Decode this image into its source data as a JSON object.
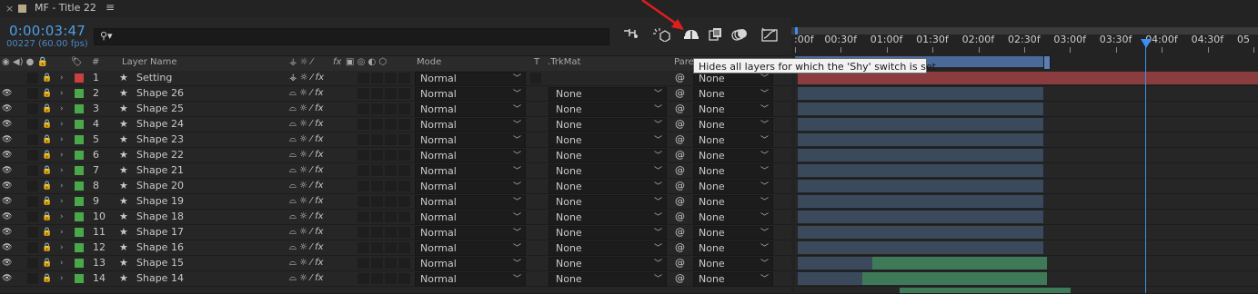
{
  "tab": {
    "close": "×",
    "title": "MF - Title 22",
    "menu": "≡"
  },
  "timecode": "0:00:03:47",
  "frames": "00227 (60.00 fps)",
  "search": {
    "placeholder": "",
    "icon": "search-icon"
  },
  "toolbar_icons": [
    "flowchart-icon",
    "draft-3d-icon",
    "shy-icon",
    "frame-blending-icon",
    "motion-blur-icon",
    "graph-editor-icon"
  ],
  "columns": {
    "layer_name": "Layer Name",
    "hash": "#",
    "mode": "Mode",
    "t": "T",
    "trkmat": "TrkMat",
    "parent": "Pare",
    "switches": "fx"
  },
  "tooltip": "Hides all layers for which the 'Shy' switch is set",
  "timeline": {
    "ticks": [
      ":00f",
      "00:30f",
      "01:00f",
      "01:30f",
      "02:00f",
      "02:30f",
      "03:00f",
      "03:30f",
      "04:00f",
      "04:30f",
      "05"
    ]
  },
  "layers": [
    {
      "num": "1",
      "name": "Setting",
      "mode": "Normal",
      "trkmat": "",
      "parent": "None",
      "label_color": "#c94040"
    },
    {
      "num": "2",
      "name": "Shape 26",
      "mode": "Normal",
      "trkmat": "None",
      "parent": "None",
      "label_color": "#4aa84a"
    },
    {
      "num": "3",
      "name": "Shape 25",
      "mode": "Normal",
      "trkmat": "None",
      "parent": "None",
      "label_color": "#4aa84a"
    },
    {
      "num": "4",
      "name": "Shape 24",
      "mode": "Normal",
      "trkmat": "None",
      "parent": "None",
      "label_color": "#4aa84a"
    },
    {
      "num": "5",
      "name": "Shape 23",
      "mode": "Normal",
      "trkmat": "None",
      "parent": "None",
      "label_color": "#4aa84a"
    },
    {
      "num": "6",
      "name": "Shape 22",
      "mode": "Normal",
      "trkmat": "None",
      "parent": "None",
      "label_color": "#4aa84a"
    },
    {
      "num": "7",
      "name": "Shape 21",
      "mode": "Normal",
      "trkmat": "None",
      "parent": "None",
      "label_color": "#4aa84a"
    },
    {
      "num": "8",
      "name": "Shape 20",
      "mode": "Normal",
      "trkmat": "None",
      "parent": "None",
      "label_color": "#4aa84a"
    },
    {
      "num": "9",
      "name": "Shape 19",
      "mode": "Normal",
      "trkmat": "None",
      "parent": "None",
      "label_color": "#4aa84a"
    },
    {
      "num": "10",
      "name": "Shape 18",
      "mode": "Normal",
      "trkmat": "None",
      "parent": "None",
      "label_color": "#4aa84a"
    },
    {
      "num": "11",
      "name": "Shape 17",
      "mode": "Normal",
      "trkmat": "None",
      "parent": "None",
      "label_color": "#4aa84a"
    },
    {
      "num": "12",
      "name": "Shape 16",
      "mode": "Normal",
      "trkmat": "None",
      "parent": "None",
      "label_color": "#4aa84a"
    },
    {
      "num": "13",
      "name": "Shape 15",
      "mode": "Normal",
      "trkmat": "None",
      "parent": "None",
      "label_color": "#4aa84a"
    },
    {
      "num": "14",
      "name": "Shape 14",
      "mode": "Normal",
      "trkmat": "None",
      "parent": "None",
      "label_color": "#4aa84a"
    }
  ],
  "colors": {
    "accent": "#4f9ee8",
    "layer_bar_setting": "#8a3c3f",
    "layer_bar_shape": "#3a4a5c",
    "layer_bar_green": "#3e7a58"
  }
}
